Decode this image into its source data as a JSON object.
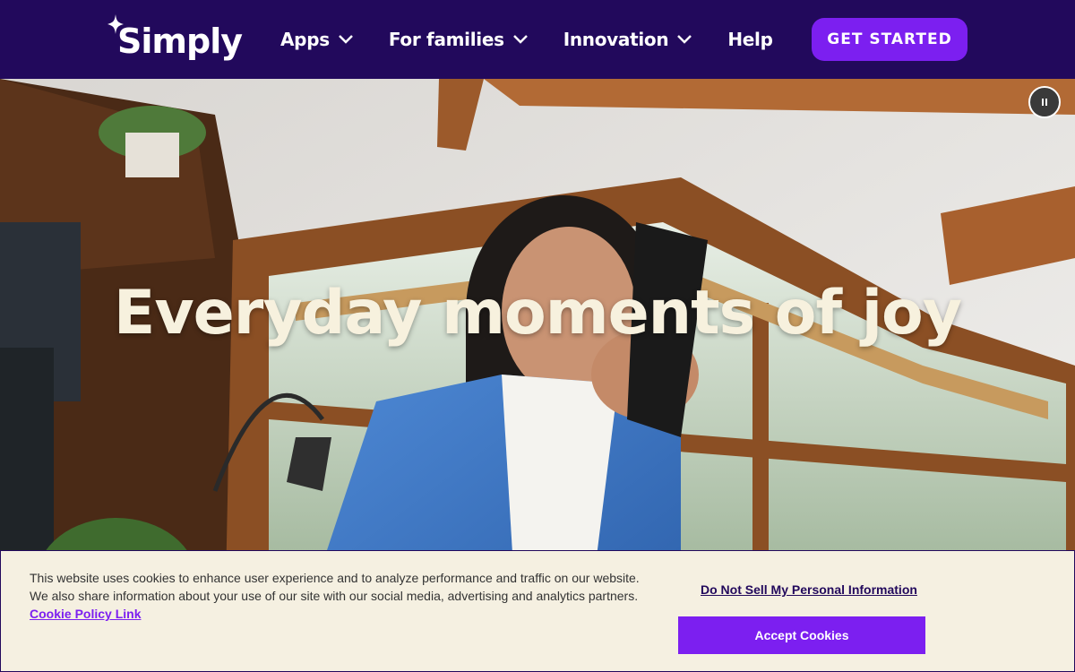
{
  "header": {
    "logo_text": "Simply",
    "nav": [
      {
        "label": "Apps",
        "has_dropdown": true
      },
      {
        "label": "For families",
        "has_dropdown": true
      },
      {
        "label": "Innovation",
        "has_dropdown": true
      },
      {
        "label": "Help",
        "has_dropdown": false
      }
    ],
    "cta_label": "GET STARTED"
  },
  "hero": {
    "title": "Everyday moments of joy",
    "pause_icon": "pause-icon"
  },
  "cookie_banner": {
    "text": "This website uses cookies to enhance user experience and to analyze performance and traffic on our website. We also share information about your use of our site with our social media, advertising and analytics partners.",
    "policy_link": "Cookie Policy Link",
    "do_not_sell": "Do Not Sell My Personal Information",
    "accept_label": "Accept Cookies"
  },
  "colors": {
    "header_bg": "#22095c",
    "accent": "#7c1ff0",
    "hero_title": "#f7f1de",
    "banner_bg": "#f5f0e1"
  }
}
